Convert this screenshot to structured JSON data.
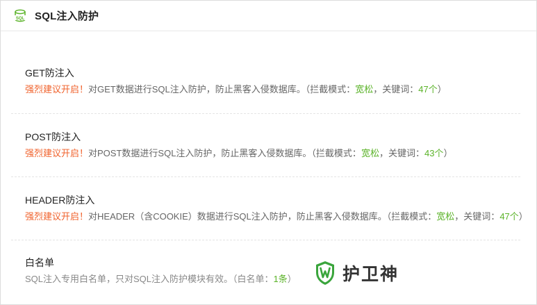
{
  "header": {
    "icon": "sql-database-icon",
    "title": "SQL注入防护",
    "accent": "#5bb329"
  },
  "items": [
    {
      "title": "GET防注入",
      "warn": "强烈建议开启！",
      "desc": "对GET数据进行SQL注入防护，防止黑客入侵数据库。（拦截模式：",
      "mode": "宽松",
      "sep": "，关键词：",
      "count": "47个",
      "close": "）"
    },
    {
      "title": "POST防注入",
      "warn": "强烈建议开启！",
      "desc": "对POST数据进行SQL注入防护，防止黑客入侵数据库。（拦截模式：",
      "mode": "宽松",
      "sep": "，关键词：",
      "count": "43个",
      "close": "）"
    },
    {
      "title": "HEADER防注入",
      "warn": "强烈建议开启！",
      "desc": "对HEADER（含COOKIE）数据进行SQL注入防护，防止黑客入侵数据库。（拦截模式：",
      "mode": "宽松",
      "sep": "，关键词：",
      "count": "47个",
      "close": "）"
    },
    {
      "title": "白名单",
      "desc": "SQL注入专用白名单，只对SQL注入防护模块有效。（白名单：",
      "count": "1条",
      "close": "）"
    }
  ],
  "watermark": {
    "icon": "shield-w-icon",
    "text": "护卫神"
  },
  "colors": {
    "warning": "#f0612b",
    "highlight": "#5bb329"
  }
}
